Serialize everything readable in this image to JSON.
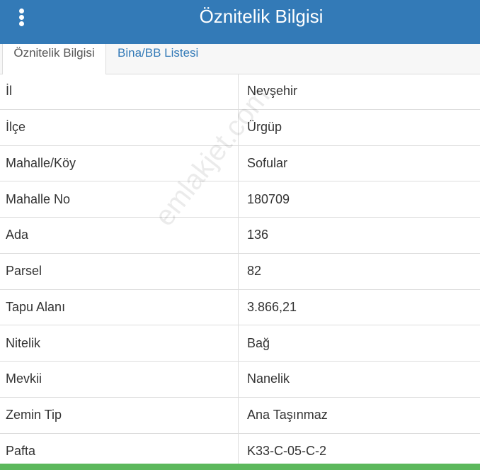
{
  "header": {
    "title": "Öznitelik Bilgisi",
    "menu_icon": "vertical-ellipsis-icon",
    "background_color": "#337ab7"
  },
  "tabs": [
    {
      "label": "Öznitelik Bilgisi",
      "active": true
    },
    {
      "label": "Bina/BB Listesi",
      "active": false
    }
  ],
  "attributes": [
    {
      "label": "İl",
      "value": "Nevşehir"
    },
    {
      "label": "İlçe",
      "value": "Ürgüp"
    },
    {
      "label": "Mahalle/Köy",
      "value": "Sofular"
    },
    {
      "label": "Mahalle No",
      "value": "180709"
    },
    {
      "label": "Ada",
      "value": "136"
    },
    {
      "label": "Parsel",
      "value": "82"
    },
    {
      "label": "Tapu Alanı",
      "value": "3.866,21"
    },
    {
      "label": "Nitelik",
      "value": "Bağ"
    },
    {
      "label": "Mevkii",
      "value": "Nanelik"
    },
    {
      "label": "Zemin Tip",
      "value": "Ana Taşınmaz"
    },
    {
      "label": "Pafta",
      "value": "K33-C-05-C-2"
    }
  ],
  "watermark": "emlakjet.com",
  "footer_bar_color": "#5cb85c"
}
